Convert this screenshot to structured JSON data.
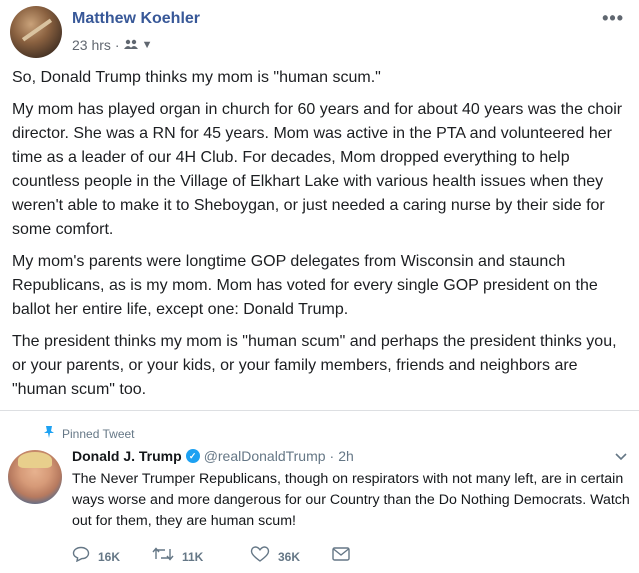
{
  "post": {
    "author": "Matthew Koehler",
    "timestamp": "23 hrs",
    "separator": "·",
    "audience_icon": "friends-icon",
    "paragraphs": [
      "So, Donald Trump thinks my mom is \"human scum.\"",
      "My mom has played organ in church for 60 years and for about 40 years was the choir director. She was a RN for 45 years. Mom was active in the PTA and volunteered her time as a leader of our 4H Club. For decades, Mom dropped everything to help countless people in the Village of Elkhart Lake with various health issues when they weren't able to make it to Sheboygan, or just needed a caring nurse by their side for some comfort.",
      "My mom's parents were longtime GOP delegates from Wisconsin and staunch Republicans, as is my mom. Mom has voted for every single GOP president on the ballot her entire life, except one: Donald Trump.",
      "The president thinks my mom is \"human scum\" and perhaps the president thinks you, or your parents, or your kids, or your family members, friends and neighbors are \"human scum\" too."
    ]
  },
  "tweet": {
    "pinned_label": "Pinned Tweet",
    "name": "Donald J. Trump",
    "handle": "@realDonaldTrump",
    "separator": "·",
    "time": "2h",
    "text": "The Never Trumper Republicans, though on respirators with not many left, are in certain ways worse and more dangerous for our Country than the Do Nothing Democrats. Watch out for them, they are human scum!",
    "replies": "16K",
    "retweets": "11K",
    "likes": "36K"
  },
  "colors": {
    "facebook_link": "#385898",
    "twitter_blue": "#1da1f2",
    "muted": "#657786"
  }
}
